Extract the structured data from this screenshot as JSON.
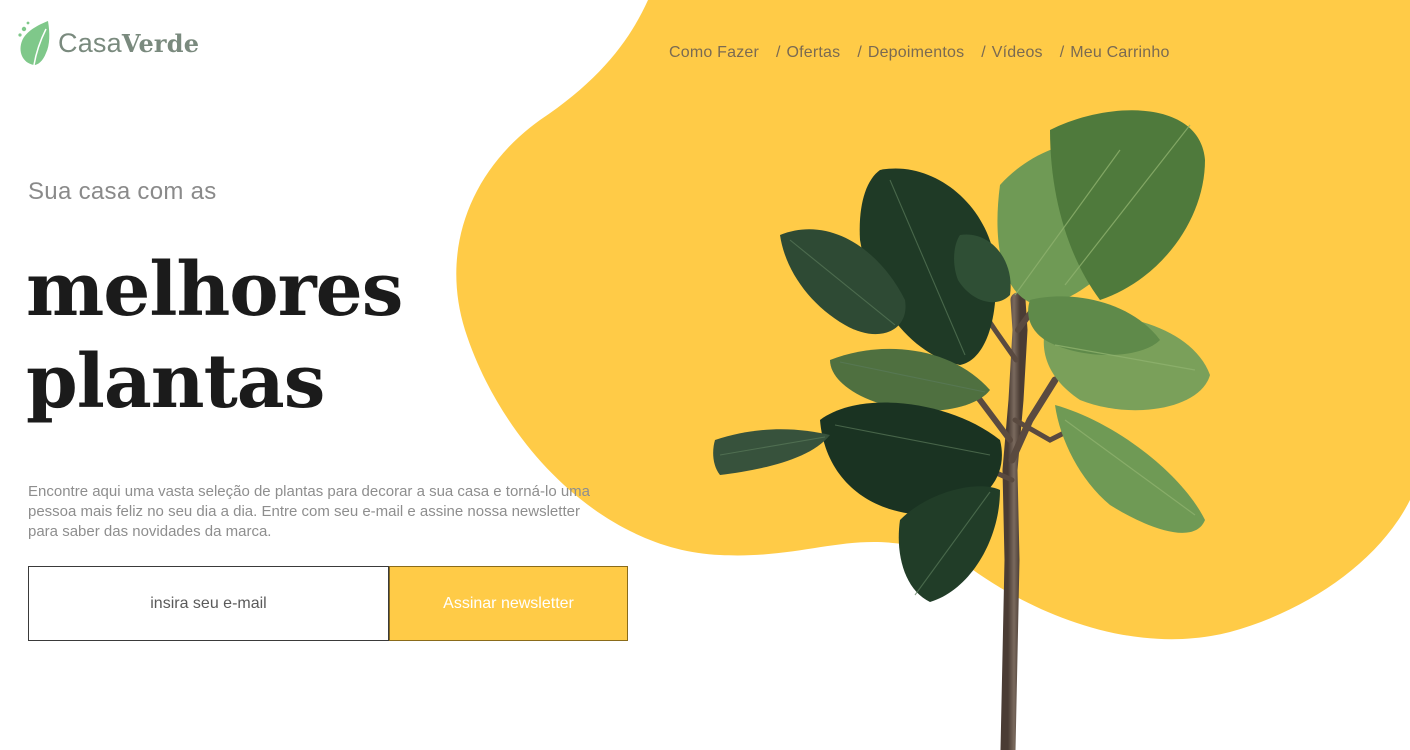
{
  "brand": {
    "name_light": "Casa",
    "name_bold": "Verde"
  },
  "nav": [
    {
      "label": "Como Fazer"
    },
    {
      "label": "Ofertas"
    },
    {
      "label": "Depoimentos"
    },
    {
      "label": "Vídeos"
    },
    {
      "label": "Meu Carrinho"
    }
  ],
  "nav_separator": "/",
  "hero": {
    "kicker": "Sua casa com as",
    "headline_line1": "melhores",
    "headline_line2": "plantas",
    "description": "Encontre aqui uma vasta seleção de plantas para decorar a sua casa e torná-lo uma pessoa mais feliz no seu dia a dia. Entre com seu e-mail e assine nossa newsletter para saber das novidades da marca."
  },
  "newsletter": {
    "email_placeholder": "insira seu e-mail",
    "email_value": "",
    "button_label": "Assinar newsletter"
  },
  "colors": {
    "accent_yellow": "#ffcb47",
    "brand_green": "#7a8a7e",
    "leaf_dark": "#1f3a26",
    "leaf_light": "#5f8a4a",
    "headline": "#1b1b1b"
  },
  "icons": {
    "logo": "leaf-icon",
    "hero_image": "fiddle-leaf-fig-plant"
  }
}
